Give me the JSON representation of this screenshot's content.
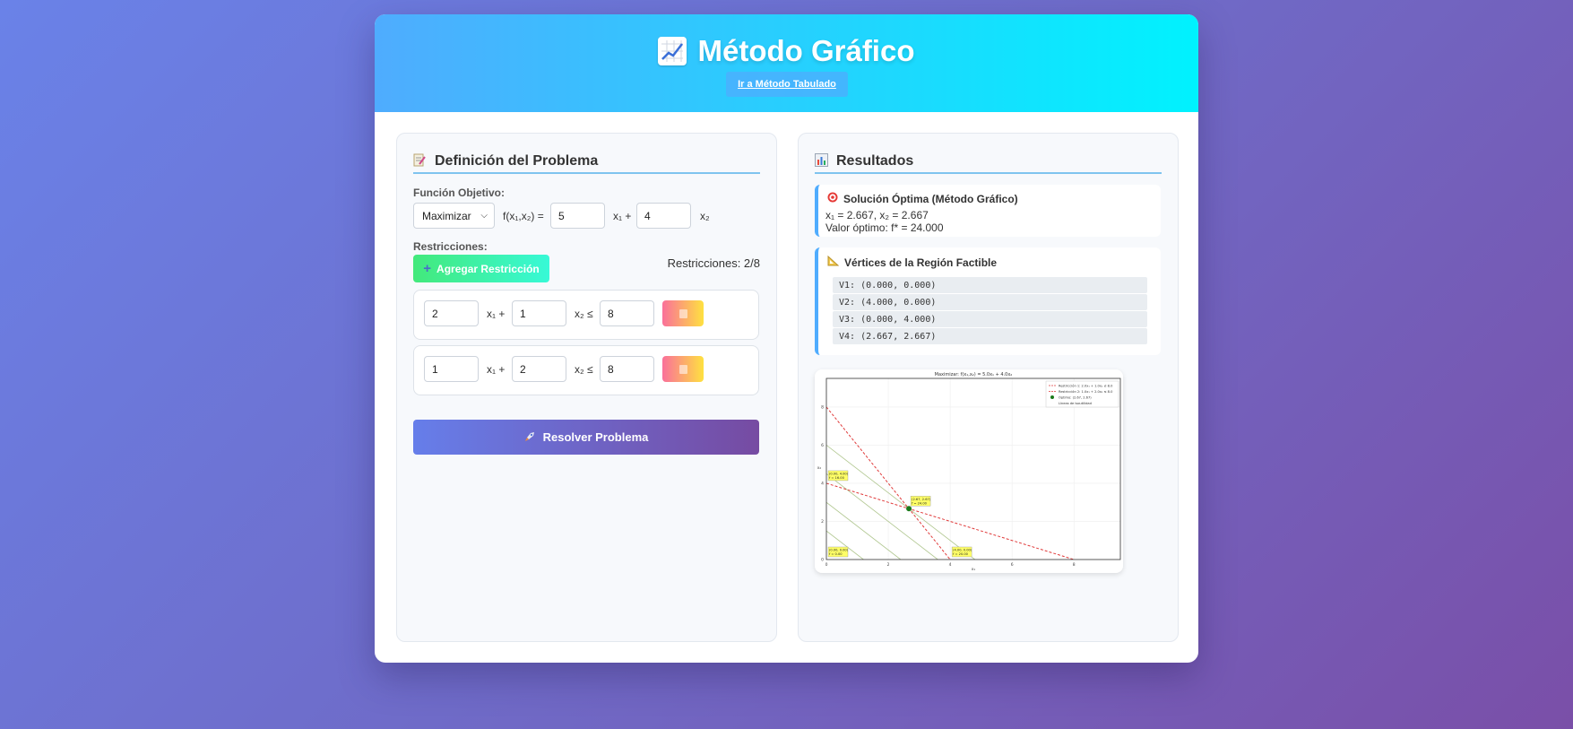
{
  "header": {
    "title": "Método Gráfico",
    "title_icon": "chart-increasing-icon",
    "nav_link": "Ir a Método Tabulado"
  },
  "left": {
    "title": "Definición del Problema",
    "title_icon": "memo-icon",
    "objective_label": "Función Objetivo:",
    "mode": "Maximizar",
    "f_label": "f(x₁,x₂) =",
    "c1": "5",
    "c2": "4",
    "x1_plus": "x₁ +",
    "x2": "x₂",
    "restrictions_label": "Restricciones:",
    "add_label": "Agregar Restricción",
    "count": "Restricciones: 2/8",
    "constraints": [
      {
        "a": "2",
        "x1": "x₁ +",
        "b": "1",
        "x2": "x₂ ≤",
        "rhs": "8"
      },
      {
        "a": "1",
        "x1": "x₁ +",
        "b": "2",
        "x2": "x₂ ≤",
        "rhs": "8"
      }
    ],
    "solve_label": "Resolver Problema"
  },
  "right": {
    "title": "Resultados",
    "title_icon": "bar-chart-icon",
    "optimal_title": "Solución Óptima (Método Gráfico)",
    "optimal_icon": "target-icon",
    "optimal_x": "x₁ = 2.667, x₂ = 2.667",
    "optimal_value": "Valor óptimo: f* = 24.000",
    "vertices_title": "Vértices de la Región Factible",
    "vertices_icon": "triangle-ruler-icon",
    "vertices": [
      "V1: (0.000, 0.000)",
      "V2: (4.000, 0.000)",
      "V3: (0.000, 4.000)",
      "V4: (2.667, 2.667)"
    ]
  },
  "chart_data": {
    "type": "line",
    "title": "Maximizar: f(x₁,x₂) = 5.0x₁ + 4.0x₂",
    "xlabel": "x₁",
    "ylabel": "x₂",
    "xlim": [
      0,
      9.5
    ],
    "ylim": [
      0,
      9.5
    ],
    "xticks": [
      "0",
      "2",
      "4",
      "6",
      "8"
    ],
    "yticks": [
      "0",
      "2",
      "4",
      "6",
      "8"
    ],
    "grid": true,
    "legend_placement": "top-right",
    "legend": [
      "Restricción 1: 2.0x₁ + 1.0x₂ ≤ 8.0",
      "Restricción 2: 1.0x₁ + 2.0x₂ ≤ 8.0",
      "Óptimo: (2.67, 2.67)",
      "Líneas de isoutilidad"
    ],
    "series": [
      {
        "name": "Restricción 1: 2.0x₁ + 1.0x₂ ≤ 8.0",
        "x": [
          0,
          4
        ],
        "y": [
          8,
          0
        ],
        "color": "#e03b3b"
      },
      {
        "name": "Restricción 2: 1.0x₁ + 2.0x₂ ≤ 8.0",
        "x": [
          0,
          8
        ],
        "y": [
          4,
          0
        ],
        "color": "#e03b3b"
      }
    ],
    "iso_lines": [
      6,
      12,
      18,
      24
    ],
    "iso_color": "#9cb873",
    "optimum": {
      "x": 2.667,
      "y": 2.667,
      "color": "#1a7a1a"
    },
    "vertex_labels": [
      {
        "x": 0,
        "y": 0,
        "label": "(0.00, 0.00)",
        "f": "f = 0.00"
      },
      {
        "x": 4,
        "y": 0,
        "label": "(4.00, 0.00)",
        "f": "f = 20.00"
      },
      {
        "x": 0,
        "y": 4,
        "label": "(0.00, 4.00)",
        "f": "f = 16.00"
      },
      {
        "x": 2.667,
        "y": 2.667,
        "label": "(2.67, 2.67)",
        "f": "f = 24.00"
      }
    ]
  }
}
